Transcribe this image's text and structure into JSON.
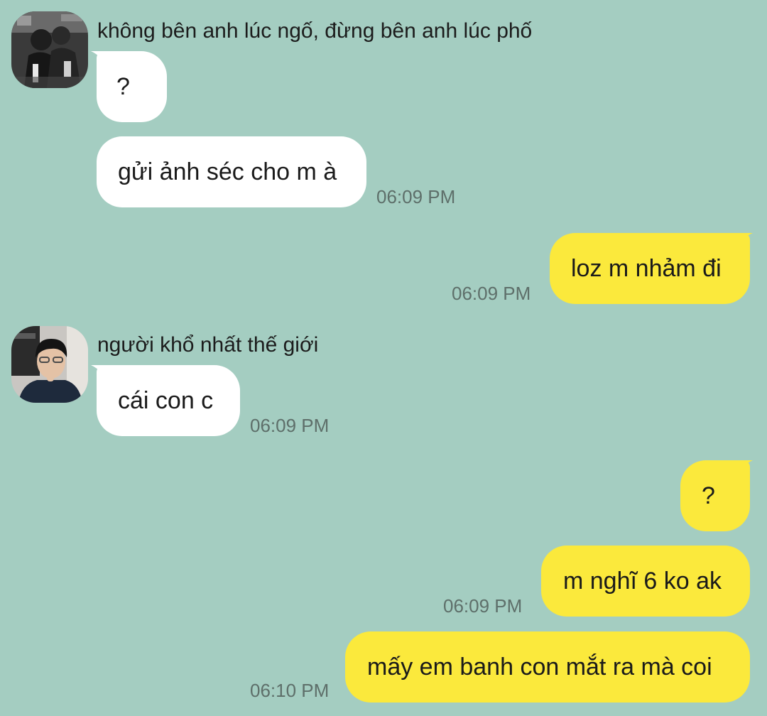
{
  "colors": {
    "background": "#a4cdc1",
    "incoming_bubble": "#ffffff",
    "outgoing_bubble": "#fbe93c",
    "timestamp": "#5e6f6a"
  },
  "senders": [
    {
      "name": "không bên anh lúc ngố, đừng bên anh lúc phố",
      "avatar": "avatar-photo-icon"
    },
    {
      "name": "người khổ nhất thế giới",
      "avatar": "avatar-photo-icon"
    }
  ],
  "messages": [
    {
      "direction": "incoming",
      "sender": 0,
      "text": "?"
    },
    {
      "direction": "incoming",
      "sender": 0,
      "text": "gửi ảnh séc cho m à",
      "time": "06:09 PM"
    },
    {
      "direction": "outgoing",
      "text": "loz m nhảm đi",
      "time": "06:09 PM"
    },
    {
      "direction": "incoming",
      "sender": 1,
      "text": "cái con c",
      "time": "06:09 PM"
    },
    {
      "direction": "outgoing",
      "text": "?"
    },
    {
      "direction": "outgoing",
      "text": "m nghĩ 6 ko ak",
      "time": "06:09 PM"
    },
    {
      "direction": "outgoing",
      "text": "mấy em banh con mắt ra mà coi",
      "time": "06:10 PM"
    }
  ]
}
